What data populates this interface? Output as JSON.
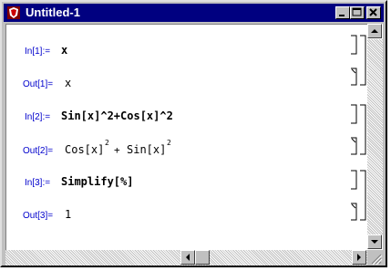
{
  "window": {
    "title": "Untitled-1"
  },
  "cells": [
    {
      "label": "In[1]:=",
      "expr": "x"
    },
    {
      "label": "Out[1]=",
      "expr": "x"
    },
    {
      "label": "In[2]:=",
      "expr": "Sin[x]^2+Cos[x]^2"
    },
    {
      "label": "Out[2]=",
      "expr_a": "Cos[x]",
      "sup_a": "2",
      "plus": "+",
      "expr_b": "Sin[x]",
      "sup_b": "2"
    },
    {
      "label": "In[3]:=",
      "expr": "Simplify[%]"
    },
    {
      "label": "Out[3]=",
      "expr": "1"
    }
  ],
  "icons": [
    "app-icon",
    "minimize-icon",
    "maximize-icon",
    "close-icon",
    "scroll-up-icon",
    "scroll-down-icon",
    "scroll-left-icon",
    "scroll-right-icon"
  ]
}
